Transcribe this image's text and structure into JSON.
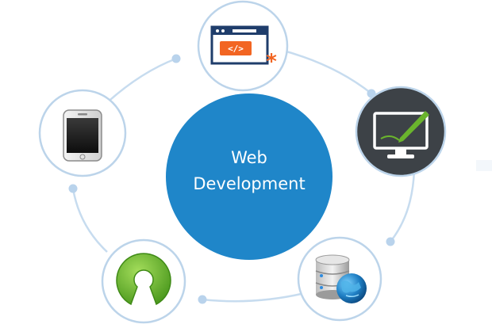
{
  "center": {
    "line1": "Web",
    "line2": "Development"
  },
  "nodes": [
    {
      "id": "code-editor",
      "icon": "code-window-icon"
    },
    {
      "id": "design",
      "icon": "monitor-pen-icon"
    },
    {
      "id": "database",
      "icon": "database-globe-icon"
    },
    {
      "id": "open-source",
      "icon": "open-source-icon"
    },
    {
      "id": "mobile",
      "icon": "smartphone-icon"
    }
  ],
  "colors": {
    "center_fill": "#1f86c9",
    "ring": "#c7dcef",
    "node_border": "#bcd4ea",
    "dark_node": "#3d4247",
    "accent_orange": "#f26522",
    "accent_green": "#6ab42d",
    "navy": "#1f3d6b"
  }
}
